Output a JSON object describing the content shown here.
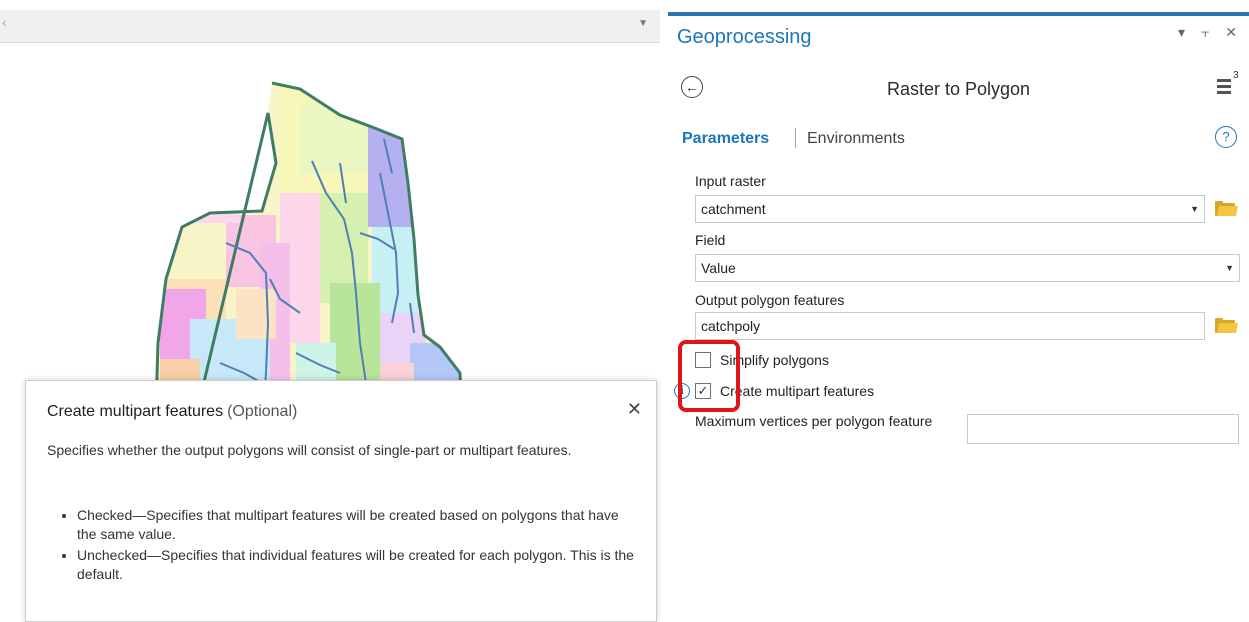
{
  "map": {
    "scroll_left_glyph": "‹",
    "dropdown_glyph": "▼",
    "colors": {
      "boundary": "#3f7d63",
      "river": "#4e7fb5"
    }
  },
  "help_popup": {
    "title": "Create multipart features",
    "optional": "(Optional)",
    "close_glyph": "✕",
    "description": "Specifies whether the output polygons will consist of single-part or multipart features.",
    "bullets": [
      "Checked—Specifies that multipart features will be created based on polygons that have the same value.",
      "Unchecked—Specifies that individual features will be created for each polygon. This is the default."
    ]
  },
  "geoprocessing": {
    "title": "Geoprocessing",
    "window_controls": "▾ ⫟ ✕",
    "tool_name": "Raster to Polygon",
    "menu_count": "3",
    "tabs": {
      "parameters": "Parameters",
      "environments": "Environments"
    },
    "help_glyph": "?",
    "params": {
      "input_raster": {
        "label": "Input raster",
        "value": "catchment"
      },
      "field": {
        "label": "Field",
        "value": "Value"
      },
      "output": {
        "label": "Output polygon features",
        "value": "catchpoly"
      },
      "simplify": {
        "label": "Simplify polygons",
        "checked": false
      },
      "multipart": {
        "label": "Create multipart features",
        "checked": true
      },
      "max_vertices": {
        "label": "Maximum vertices per polygon feature",
        "value": ""
      }
    },
    "accent_color": "#1d76b8",
    "highlight_color": "#e01515"
  }
}
